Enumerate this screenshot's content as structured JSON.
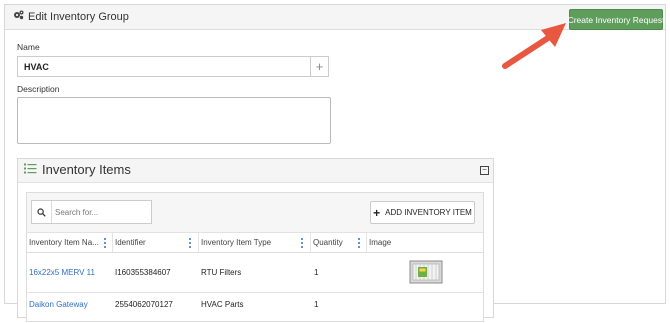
{
  "header": {
    "title": "Edit Inventory Group",
    "create_button": "Create Inventory Request"
  },
  "form": {
    "name_label": "Name",
    "name_value": "HVAC",
    "description_label": "Description",
    "description_value": ""
  },
  "inventory": {
    "title": "Inventory Items",
    "search_placeholder": "Search for...",
    "add_button": "ADD INVENTORY ITEM",
    "columns": [
      "Inventory Item Na...",
      "Identifier",
      "Inventory Item Type",
      "Quantity",
      "Image"
    ],
    "rows": [
      {
        "name": "16x22x5 MERV 11",
        "identifier": "I160355384607",
        "type": "RTU Filters",
        "quantity": "1"
      },
      {
        "name": "Daikon Gateway",
        "identifier": "2554062070127",
        "type": "HVAC Parts",
        "quantity": "1"
      }
    ]
  },
  "colors": {
    "primary_green": "#5f9d5c",
    "link_blue": "#2e6fc7",
    "arrow_red": "#e8573f"
  },
  "icons": [
    "gears-icon",
    "plus-icon",
    "list-icon",
    "collapse-icon",
    "search-icon",
    "add-icon",
    "column-menu-icon",
    "filter-image"
  ]
}
